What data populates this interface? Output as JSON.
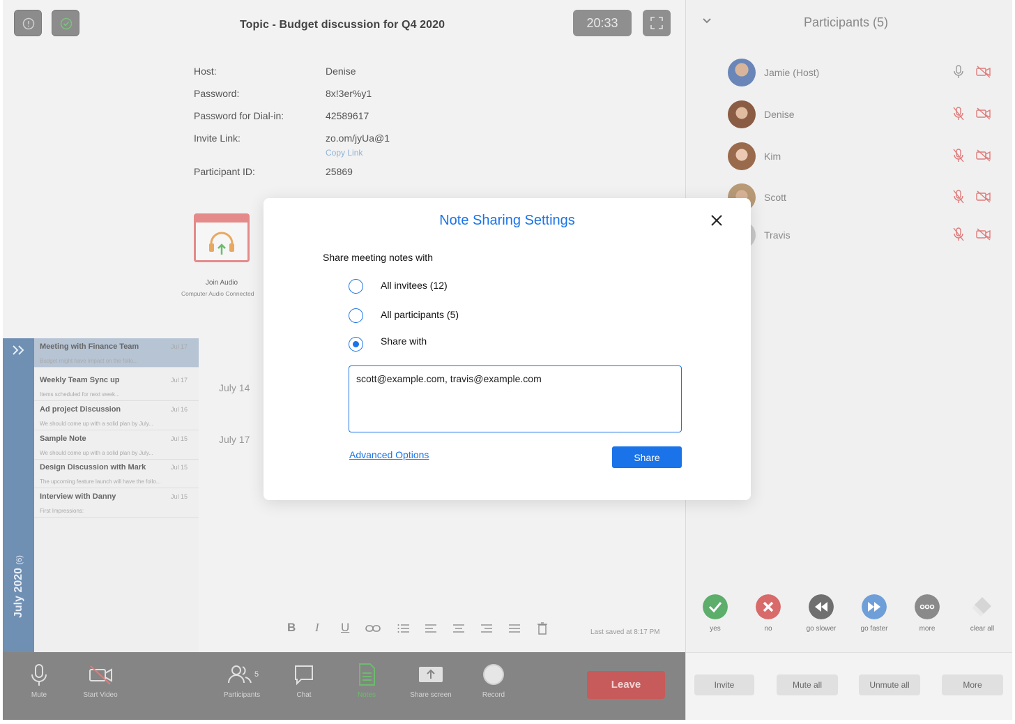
{
  "meeting": {
    "topic": "Topic - Budget discussion for Q4 2020",
    "timer": "20:33",
    "info": [
      {
        "label": "Host:",
        "value": "Denise"
      },
      {
        "label": "Password:",
        "value": "8x!3er%y1"
      },
      {
        "label": "Password for Dial-in:",
        "value": "42589617"
      },
      {
        "label": "Invite Link:",
        "value": "zo.om/jyUa@1"
      },
      {
        "label": "Participant ID:",
        "value": "25869"
      }
    ],
    "copy_link": "Copy Link",
    "join_audio": {
      "label": "Join Audio",
      "sub": "Computer Audio Connected"
    }
  },
  "notes": {
    "month": "July 2020",
    "month_count": "(6)",
    "items": [
      {
        "title": "Meeting with Finance Team",
        "date": "Jul 17",
        "snippet": "Budget might have impact on the follo..."
      },
      {
        "title": "Weekly Team Sync up",
        "date": "Jul 17",
        "snippet": "Items scheduled for next week..."
      },
      {
        "title": "Ad project Discussion",
        "date": "Jul 16",
        "snippet": "We should come up with a solid plan by July..."
      },
      {
        "title": "Sample Note",
        "date": "Jul 15",
        "snippet": "We should come up with a solid plan by July..."
      },
      {
        "title": "Design Discussion with Mark",
        "date": "Jul 15",
        "snippet": "The upcoming feature launch will have the follo..."
      },
      {
        "title": "Interview with Danny",
        "date": "Jul 15",
        "snippet": "First Impressions:"
      }
    ],
    "date_tags": [
      "July 14",
      "July 17"
    ],
    "last_saved": "Last saved at 8:17 PM",
    "format_icons": [
      "bold-icon",
      "italic-icon",
      "underline-icon",
      "link-icon",
      "bulleted-list-icon",
      "align-left-icon",
      "align-center-icon",
      "align-right-icon",
      "justify-icon",
      "trash-icon"
    ]
  },
  "toolbar": {
    "mute": "Mute",
    "start_video": "Start Video",
    "participants": "Participants",
    "participants_count": "5",
    "chat": "Chat",
    "notes": "Notes",
    "share_screen": "Share screen",
    "record": "Record",
    "leave": "Leave"
  },
  "participants_panel": {
    "title": "Participants (5)",
    "people": [
      {
        "name": "Jamie (Host)",
        "mic_muted": false,
        "video_off": true
      },
      {
        "name": "Denise",
        "mic_muted": true,
        "video_off": true
      },
      {
        "name": "Kim",
        "mic_muted": true,
        "video_off": true
      },
      {
        "name": "Scott",
        "mic_muted": true,
        "video_off": true
      },
      {
        "name": "Travis",
        "mic_muted": true,
        "video_off": true
      }
    ],
    "reactions": [
      {
        "label": "yes",
        "color": "#5cae6a"
      },
      {
        "label": "no",
        "color": "#d86a6a"
      },
      {
        "label": "go slower",
        "color": "#6f6f6f"
      },
      {
        "label": "go faster",
        "color": "#6f9fd8"
      },
      {
        "label": "more",
        "color": "#8a8a8a"
      },
      {
        "label": "clear all",
        "color": "#d6d6d6"
      }
    ],
    "footer": {
      "invite": "Invite",
      "mute_all": "Mute all",
      "unmute_all": "Unmute all",
      "more": "More"
    }
  },
  "modal": {
    "title": "Note Sharing Settings",
    "prompt": "Share meeting notes with",
    "options": [
      {
        "label": "All invitees (12)",
        "checked": false
      },
      {
        "label": "All participants (5)",
        "checked": false
      },
      {
        "label": "Share with",
        "checked": true
      }
    ],
    "emails_value": "scott@example.com, travis@example.com",
    "advanced_link": "Advanced Options",
    "share_button": "Share"
  },
  "colors": {
    "accent": "#1a73e8",
    "leave": "#c75a5a",
    "notes_active": "#5cae6a",
    "muted": "#e07a7a"
  }
}
